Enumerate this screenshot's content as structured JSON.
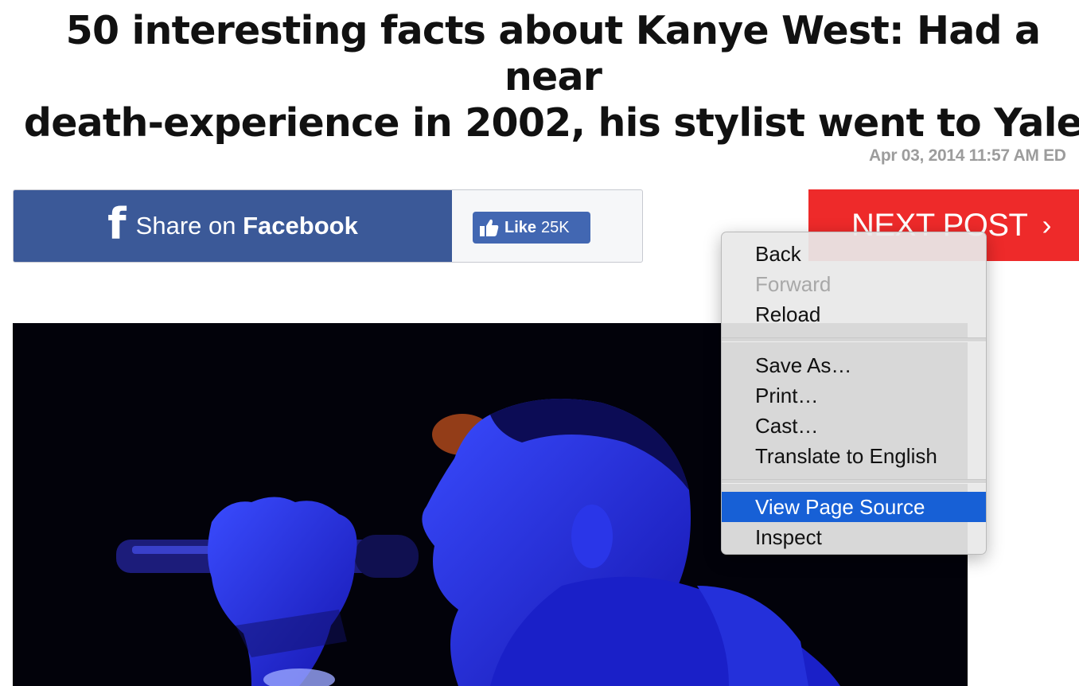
{
  "article": {
    "title_line1": "50 interesting facts about Kanye West: Had a near",
    "title_line2": "death-experience in 2002, his stylist went to Yale",
    "dateline": "Apr 03, 2014 11:57 AM ED"
  },
  "share": {
    "facebook_icon": "f",
    "share_prefix": "Share on ",
    "share_brand": "Facebook",
    "like_label": "Like",
    "like_count": "25K"
  },
  "next_post": {
    "label": "NEXT POST",
    "chevron": "›"
  },
  "context_menu": {
    "group1": [
      "Back",
      "Forward",
      "Reload"
    ],
    "group2": [
      "Save As…",
      "Print…",
      "Cast…",
      "Translate to English"
    ],
    "group3": [
      "View Page Source",
      "Inspect"
    ],
    "disabled_item": "Forward",
    "selected_item": "View Page Source"
  },
  "colors": {
    "facebook_blue": "#3b5998",
    "like_blue": "#4267b2",
    "next_red": "#ee2a2a",
    "menu_highlight": "#1760d6"
  },
  "icons": [
    "facebook-f-icon",
    "thumbs-up-icon",
    "chevron-right-icon"
  ]
}
